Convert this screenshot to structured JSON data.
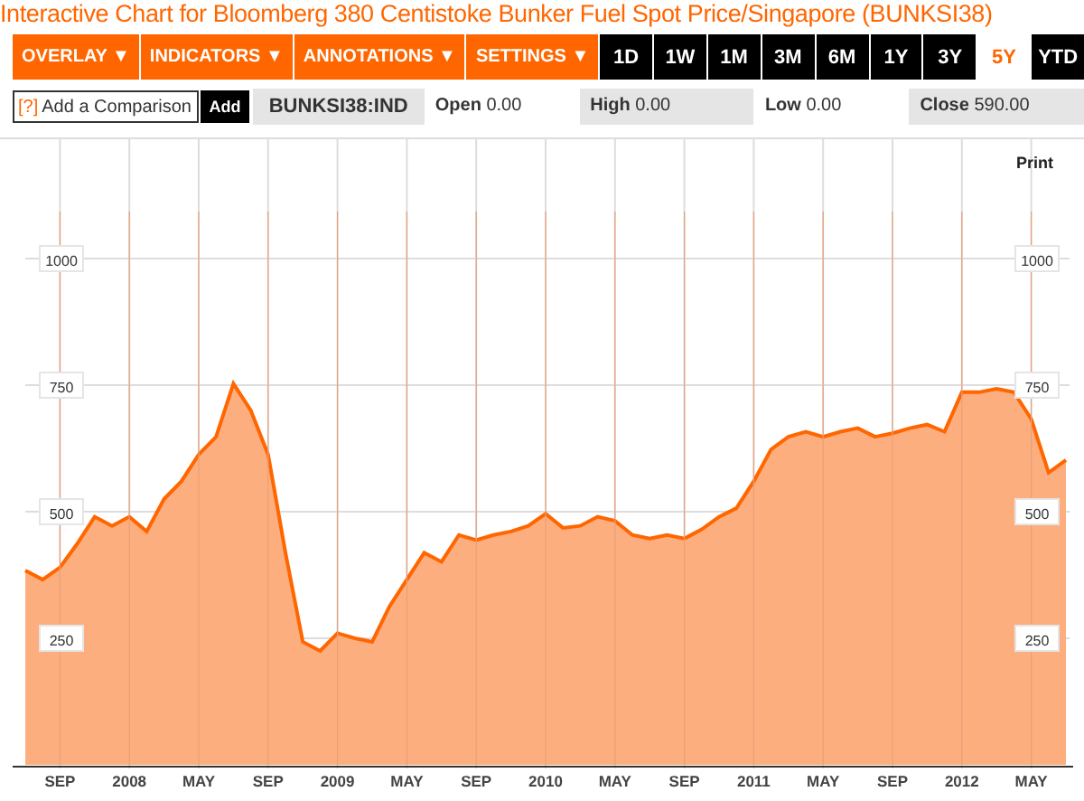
{
  "title": "Interactive Chart for Bloomberg 380 Centistoke Bunker Fuel Spot Price/Singapore (BUNKSI38)",
  "menus": [
    {
      "label": "OVERLAY",
      "caret": "▼"
    },
    {
      "label": "INDICATORS",
      "caret": "▼"
    },
    {
      "label": "ANNOTATIONS",
      "caret": "▼"
    },
    {
      "label": "SETTINGS",
      "caret": "▼"
    }
  ],
  "ranges": [
    {
      "label": "1D",
      "selected": false
    },
    {
      "label": "1W",
      "selected": false
    },
    {
      "label": "1M",
      "selected": false
    },
    {
      "label": "3M",
      "selected": false
    },
    {
      "label": "6M",
      "selected": false
    },
    {
      "label": "1Y",
      "selected": false
    },
    {
      "label": "3Y",
      "selected": false
    },
    {
      "label": "5Y",
      "selected": true
    },
    {
      "label": "YTD",
      "selected": false
    }
  ],
  "comparison": {
    "help": "[?]",
    "placeholder": "Add a Comparison",
    "button": "Add"
  },
  "ticker": "BUNKSI38:IND",
  "quotes": [
    {
      "label": "Open",
      "value": "0.00",
      "shaded": false
    },
    {
      "label": "High",
      "value": "0.00",
      "shaded": true
    },
    {
      "label": "Low",
      "value": "0.00",
      "shaded": false
    },
    {
      "label": "Close",
      "value": "590.00",
      "shaded": true
    }
  ],
  "print": "Print",
  "right_axis_labels": [
    "1000",
    "750",
    "500",
    "250"
  ],
  "chart_data": {
    "type": "area",
    "categories": [
      null,
      null,
      "SEP",
      null,
      null,
      null,
      "2008",
      null,
      null,
      null,
      "MAY",
      null,
      null,
      null,
      "SEP",
      null,
      null,
      null,
      "2009",
      null,
      null,
      null,
      "MAY",
      null,
      null,
      null,
      "SEP",
      null,
      null,
      null,
      "2010",
      null,
      null,
      null,
      "MAY",
      null,
      null,
      null,
      "SEP",
      null,
      null,
      null,
      "2011",
      null,
      null,
      null,
      "MAY",
      null,
      null,
      null,
      "SEP",
      null,
      null,
      null,
      "2012",
      null,
      null,
      null,
      "MAY",
      null,
      null
    ],
    "values": [
      384,
      366,
      390,
      437,
      490,
      472,
      490,
      461,
      525,
      560,
      613,
      648,
      753,
      700,
      613,
      419,
      243,
      225,
      260,
      250,
      243,
      313,
      366,
      419,
      401,
      454,
      444,
      454,
      461,
      472,
      496,
      468,
      472,
      490,
      482,
      454,
      447,
      454,
      447,
      465,
      490,
      507,
      560,
      623,
      648,
      658,
      648,
      658,
      665,
      648,
      655,
      665,
      672,
      658,
      736,
      736,
      743,
      736,
      683,
      577,
      602
    ],
    "grid": true,
    "ylim": [
      0,
      1100
    ],
    "yticks": [
      250,
      500,
      750,
      1000
    ]
  }
}
